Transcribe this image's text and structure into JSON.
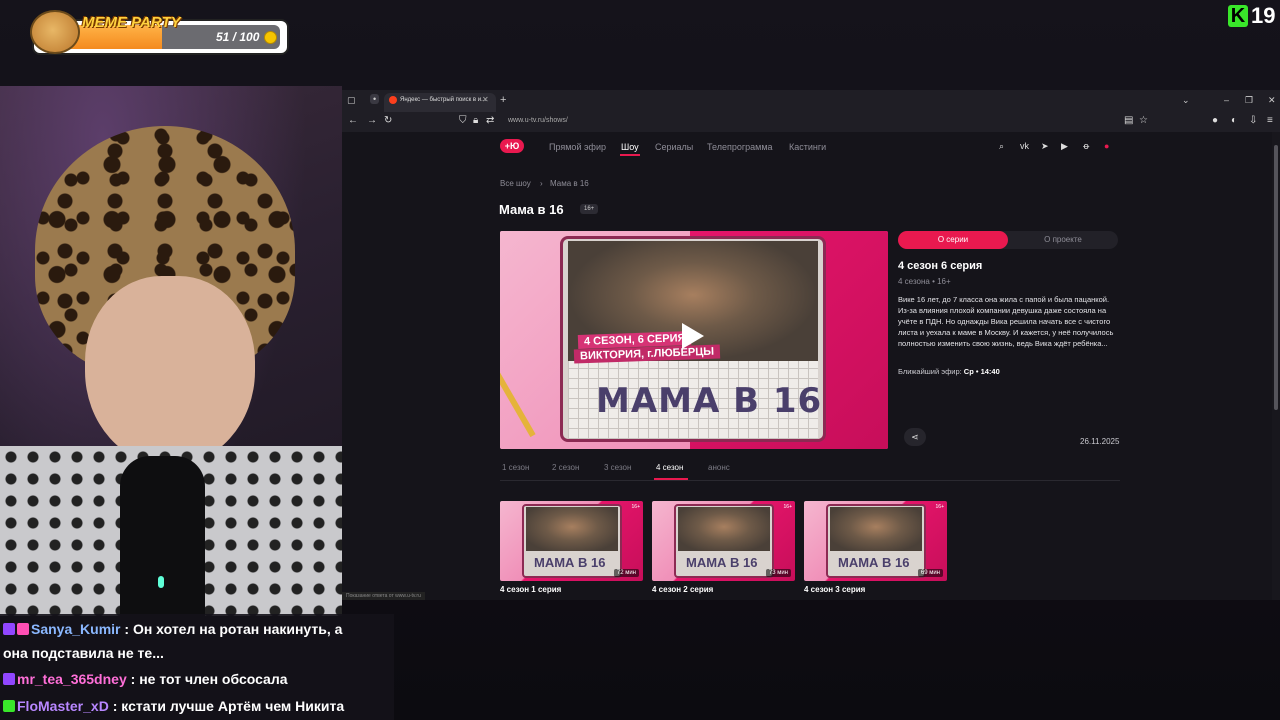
{
  "meme_widget": {
    "title": "MEME PARTY",
    "count": "51 / 100",
    "progress_fraction": 0.51
  },
  "k_badge": {
    "letter": "K",
    "count": "19"
  },
  "browser": {
    "tab_title": "Яндекс — быстрый поиск в и...",
    "url": "www.u-tv.ru/shows/",
    "status_tip": "Показание ответа от www.u-tv.ru"
  },
  "site": {
    "logo": "+Ю",
    "nav": [
      "Прямой эфир",
      "Шоу",
      "Сериалы",
      "Телепрограмма",
      "Кастинги"
    ],
    "nav_active": "Шоу",
    "breadcrumb": [
      "Все шоу",
      "Мама в 16"
    ],
    "title": "Мама в 16",
    "age": "16+",
    "player": {
      "label_line1": "4 СЕЗОН, 6 СЕРИЯ",
      "label_line2": "ВИКТОРИЯ, г.ЛЮБЕРЦЫ",
      "logo_text": "МАМА В 16"
    },
    "info_tabs": [
      "О серии",
      "О проекте"
    ],
    "episode_title": "4 сезон 6 серия",
    "episode_sub": "4 сезона • 16+",
    "episode_desc": "Вике 16 лет, до 7 класса она жила с папой и была пацанкой. Из-за влияния плохой компании девушка даже состояла на учёте в ПДН. Но однажды Вика решила начать все с чистого листа и уехала к маме в Москву. И кажется, у неё получилось полностью изменить свою жизнь, ведь Вика ждёт ребёнка...",
    "air_label": "Ближайший эфир:",
    "air_value": "Ср • 14:40",
    "date": "26.11.2025",
    "seasons": [
      "1 сезон",
      "2 сезон",
      "3 сезон",
      "4 сезон",
      "анонс"
    ],
    "season_active": "4 сезон",
    "episodes": [
      {
        "caption": "4 сезон 1 серия",
        "duration": "72 мин",
        "age": "16+",
        "thumb_title": "МАМА В 16"
      },
      {
        "caption": "4 сезон 2 серия",
        "duration": "73 мин",
        "age": "16+",
        "thumb_title": "МАМА В 16"
      },
      {
        "caption": "4 сезон 3 серия",
        "duration": "69 мин",
        "age": "16+",
        "thumb_title": "МАМА В 16"
      }
    ]
  },
  "chat": [
    {
      "nick": "Sanya_Kumir",
      "sep": " : ",
      "text": "Он хотел на ротан накинуть, а",
      "text2": "она подставила не те..."
    },
    {
      "nick": "mr_tea_365dney",
      "sep": " : ",
      "text": "не тот член обсосала"
    },
    {
      "nick": "FloMaster_xD",
      "sep": " : ",
      "text": "кстати лучше Артём чем Никита"
    }
  ],
  "colors": {
    "accent": "#e9194f",
    "kick_green": "#39e62a",
    "twitch_purple": "#9146ff"
  }
}
